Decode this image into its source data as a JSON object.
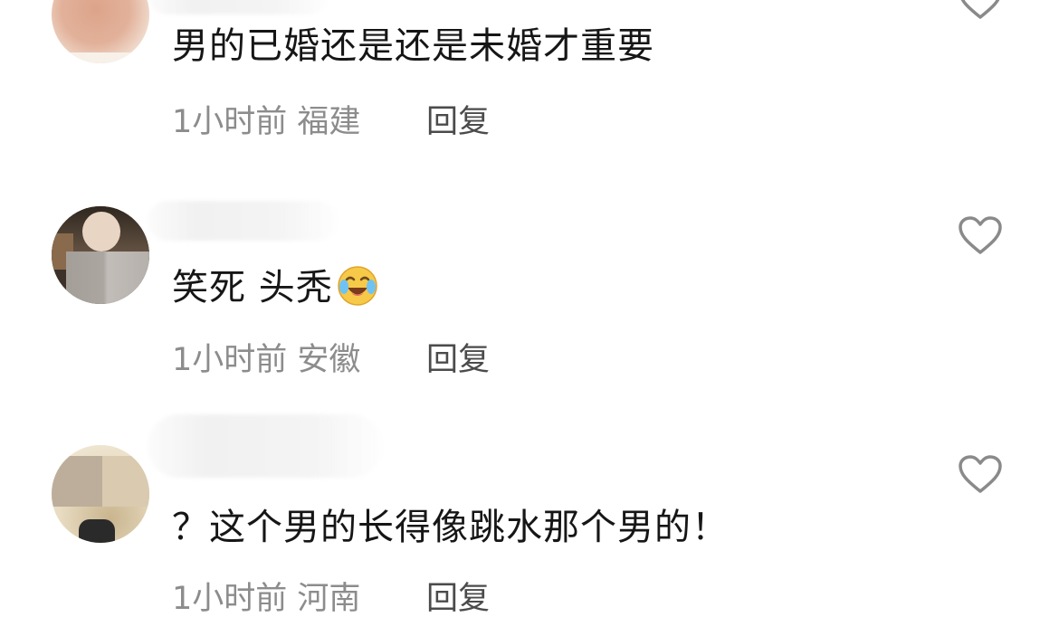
{
  "comments": [
    {
      "text": "男的已婚还是还是未婚才重要",
      "time": "1小时前",
      "location": "福建",
      "reply_label": "回复"
    },
    {
      "text": "笑死 头秃",
      "time": "1小时前",
      "location": "安徽",
      "reply_label": "回复"
    },
    {
      "text": "？这个男的长得像跳水那个男的！",
      "time": "1小时前",
      "location": "河南",
      "reply_label": "回复"
    }
  ],
  "colors": {
    "text": "#161616",
    "meta": "#8c8c8c",
    "reply": "#4b4b4b",
    "heart_outline": "#8a8a8a"
  },
  "icons": {
    "like": "heart-outline-icon",
    "emoji": "laughing-crying-emoji-icon"
  }
}
